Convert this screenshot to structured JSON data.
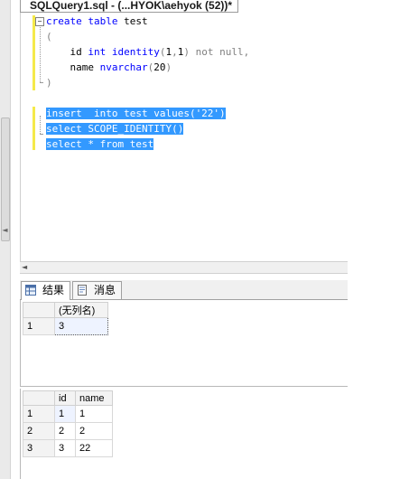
{
  "window": {
    "tab_title": "SQLQuery1.sql - (...HYOK\\aehyok (52))*"
  },
  "editor": {
    "collapse_symbol": "−",
    "lines": [
      {
        "tokens": [
          {
            "t": "create",
            "c": "kw"
          },
          {
            "t": " ",
            "c": ""
          },
          {
            "t": "table",
            "c": "kw"
          },
          {
            "t": " test",
            "c": ""
          }
        ],
        "selected": false
      },
      {
        "tokens": [
          {
            "t": "(",
            "c": "gr"
          }
        ],
        "selected": false
      },
      {
        "tokens": [
          {
            "t": "    id ",
            "c": ""
          },
          {
            "t": "int",
            "c": "kw"
          },
          {
            "t": " ",
            "c": ""
          },
          {
            "t": "identity",
            "c": "kw"
          },
          {
            "t": "(",
            "c": "gr"
          },
          {
            "t": "1",
            "c": ""
          },
          {
            "t": ",",
            "c": "gr"
          },
          {
            "t": "1",
            "c": ""
          },
          {
            "t": ")",
            "c": "gr"
          },
          {
            "t": " ",
            "c": ""
          },
          {
            "t": "not",
            "c": "gr"
          },
          {
            "t": " ",
            "c": ""
          },
          {
            "t": "null",
            "c": "gr"
          },
          {
            "t": ",",
            "c": "gr"
          }
        ],
        "selected": false
      },
      {
        "tokens": [
          {
            "t": "    name ",
            "c": ""
          },
          {
            "t": "nvarchar",
            "c": "kw"
          },
          {
            "t": "(",
            "c": "gr"
          },
          {
            "t": "20",
            "c": ""
          },
          {
            "t": ")",
            "c": "gr"
          }
        ],
        "selected": false
      },
      {
        "tokens": [
          {
            "t": ")",
            "c": "gr"
          }
        ],
        "selected": false
      },
      {
        "tokens": [],
        "selected": false
      },
      {
        "tokens": [
          {
            "t": "insert  into test values('22')",
            "c": ""
          }
        ],
        "selected": true
      },
      {
        "tokens": [
          {
            "t": "select SCOPE_IDENTITY()",
            "c": ""
          }
        ],
        "selected": true
      },
      {
        "tokens": [
          {
            "t": "select * from test",
            "c": ""
          }
        ],
        "selected": true
      }
    ]
  },
  "results_tabs": [
    {
      "label": "结果",
      "icon": "grid-icon"
    },
    {
      "label": "消息",
      "icon": "messages-icon"
    }
  ],
  "grid1": {
    "columns": [
      "(无列名)"
    ],
    "rows": [
      [
        "1",
        "3"
      ]
    ]
  },
  "grid2": {
    "columns": [
      "id",
      "name"
    ],
    "rows": [
      [
        "1",
        "1",
        "1"
      ],
      [
        "2",
        "2",
        "2"
      ],
      [
        "3",
        "3",
        "22"
      ]
    ]
  },
  "scroll": {
    "left_arrow": "◄",
    "gutter_arrow": "◄"
  }
}
